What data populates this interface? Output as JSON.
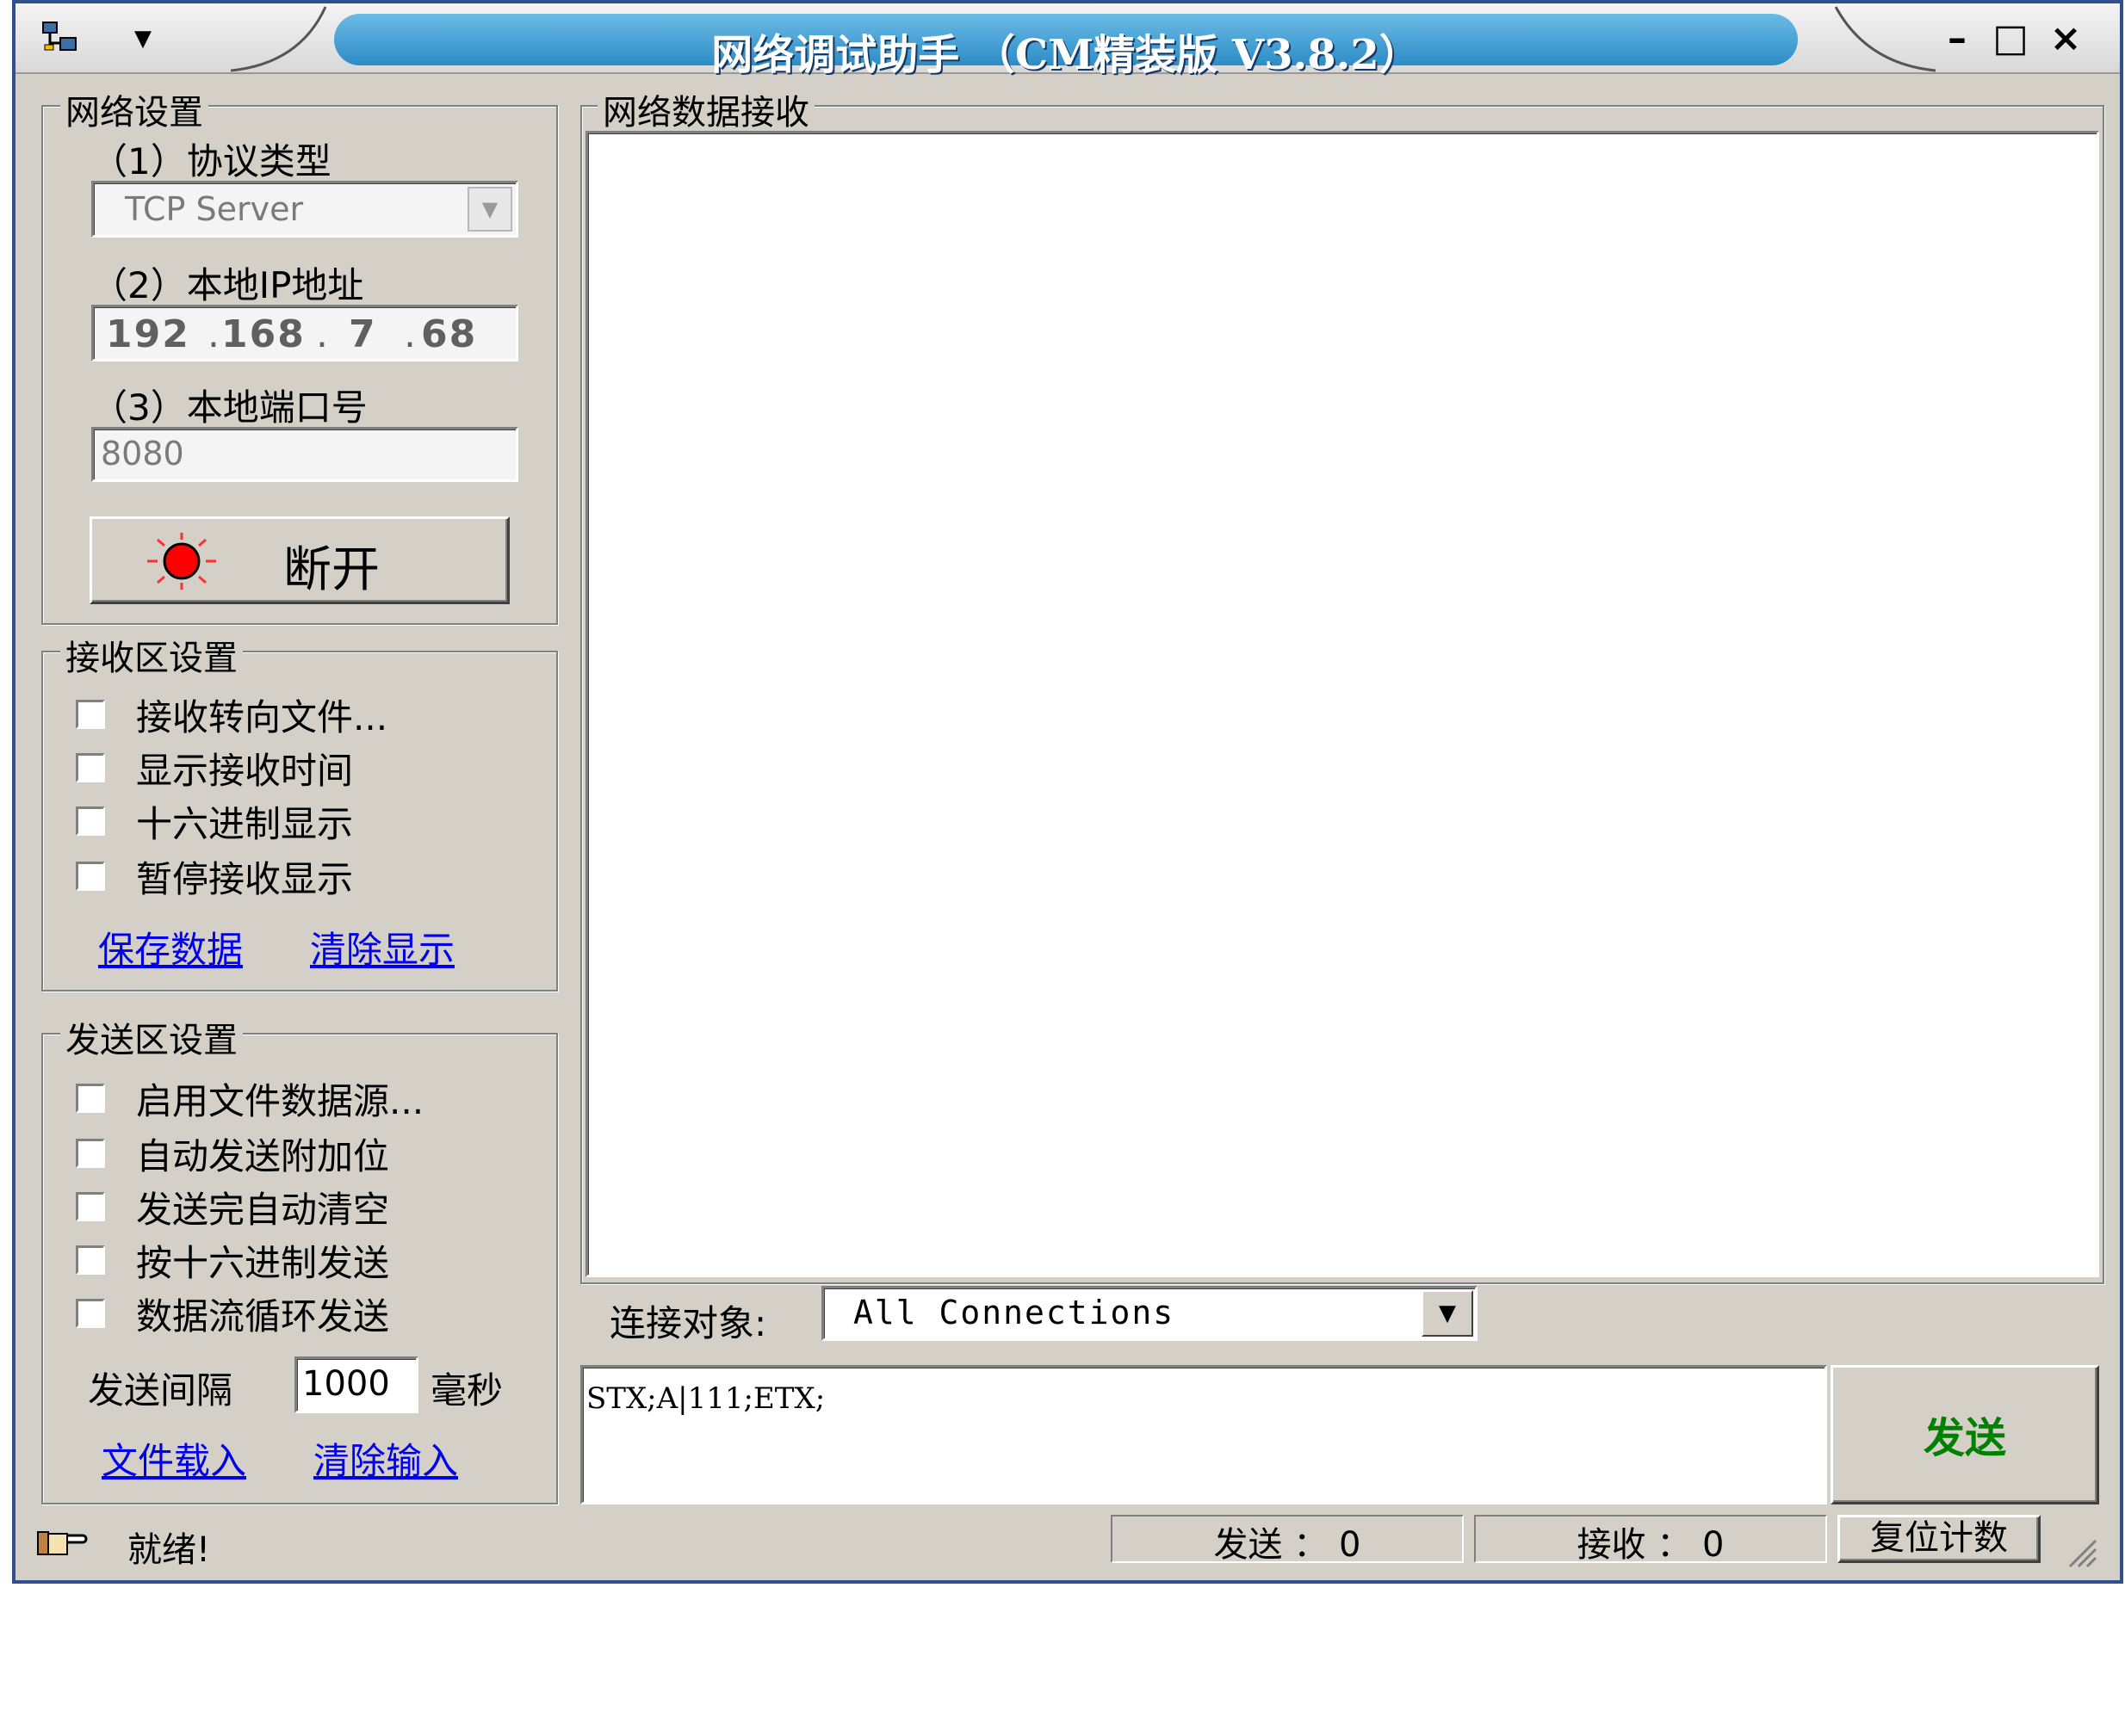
{
  "window": {
    "title": "网络调试助手 （CM精装版 V3.8.2）",
    "minimize": "–",
    "maximize": "□",
    "close": "×"
  },
  "network_settings": {
    "legend": "网络设置",
    "protocol_label": "（1）协议类型",
    "protocol_value": "TCP Server",
    "ip_label": "（2）本地IP地址",
    "ip_parts": [
      "192",
      "168",
      "7",
      "68"
    ],
    "port_label": "（3）本地端口号",
    "port_value": "8080",
    "disconnect_label": "断开"
  },
  "receive_settings": {
    "legend": "接收区设置",
    "options": [
      "接收转向文件...",
      "显示接收时间",
      "十六进制显示",
      "暂停接收显示"
    ],
    "save_link": "保存数据",
    "clear_link": "清除显示"
  },
  "send_settings": {
    "legend": "发送区设置",
    "options": [
      "启用文件数据源...",
      "自动发送附加位",
      "发送完自动清空",
      "按十六进制发送",
      "数据流循环发送"
    ],
    "interval_label": "发送间隔",
    "interval_value": "1000",
    "interval_unit": "毫秒",
    "load_link": "文件载入",
    "clear_link": "清除输入"
  },
  "receive_area": {
    "legend": "网络数据接收",
    "content": ""
  },
  "connection": {
    "label": "连接对象:",
    "value": "All Connections"
  },
  "send_area": {
    "content": "STX;A|111;ETX;",
    "send_button": "发送"
  },
  "status_bar": {
    "status_text": "就绪!",
    "sent_label": "发送 ： 0",
    "received_label": "接收 ： 0",
    "reset_button": "复位计数"
  },
  "colors": {
    "title_accent": "#2d8cc6",
    "window_border": "#2f4f8f",
    "link": "#0000ee",
    "send_button_text": "#008000",
    "led": "#ff0000"
  }
}
